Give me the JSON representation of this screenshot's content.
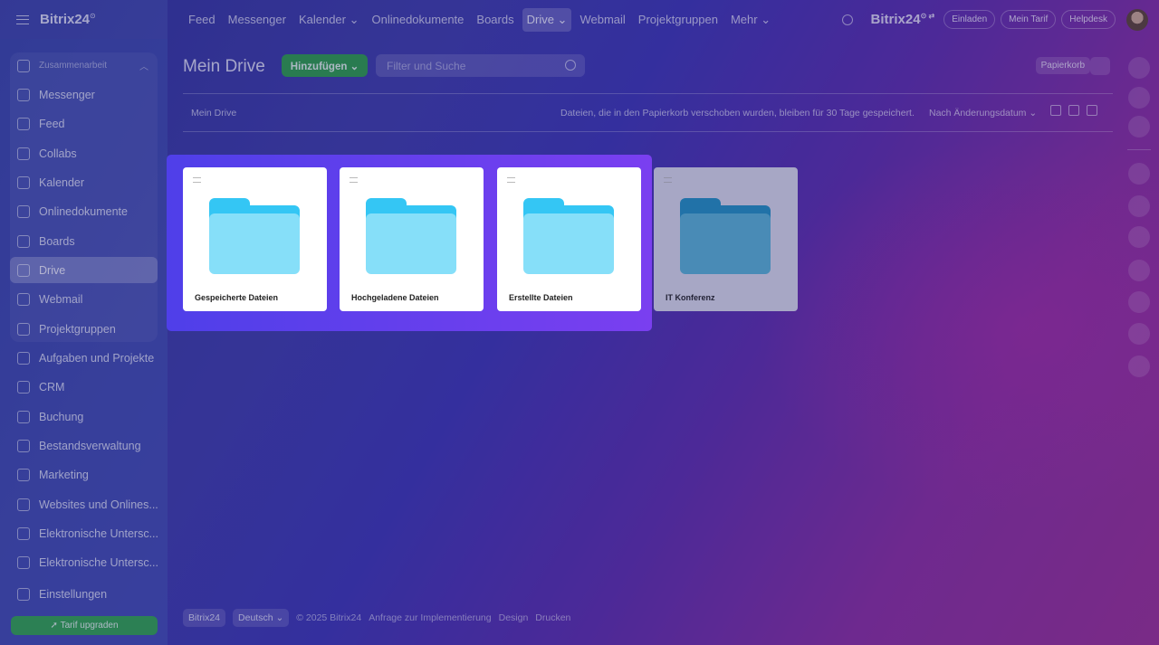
{
  "topbar": {
    "brand": "Bitrix24",
    "nav": [
      "Feed",
      "Messenger",
      "Kalender ⌄",
      "Onlinedokumente",
      "Boards",
      "Drive ⌄",
      "Webmail",
      "Projektgruppen",
      "Mehr ⌄"
    ],
    "active": 5,
    "right_brand": "Bitrix24",
    "buttons": [
      "Einladen",
      "Mein Tarif",
      "Helpdesk"
    ]
  },
  "sidebar": {
    "group_label": "Zusammenarbeit",
    "items": [
      "Messenger",
      "Feed",
      "Collabs",
      "Kalender",
      "Onlinedokumente",
      "Boards",
      "Drive",
      "Webmail",
      "Projektgruppen",
      "Aufgaben und Projekte",
      "CRM",
      "Buchung",
      "Bestandsverwaltung",
      "Marketing",
      "Websites und Onlines...",
      "Elektronische Untersc...",
      "Elektronische Untersc...",
      "Einstellungen"
    ],
    "active": "Drive",
    "upgrade": "Tarif upgraden"
  },
  "main": {
    "title": "Mein Drive",
    "add_label": "Hinzufügen ⌄",
    "filter_placeholder": "Filter und Suche",
    "trash_label": "Papierkorb",
    "breadcrumb": "Mein Drive",
    "info": "Dateien, die in den Papierkorb verschoben wurden, bleiben für 30 Tage gespeichert.",
    "sort": "Nach Änderungsdatum ⌄"
  },
  "folders": [
    "Gespeicherte Dateien",
    "Hochgeladene Dateien",
    "Erstellte Dateien",
    "IT Konferenz"
  ],
  "footer": {
    "brand": "Bitrix24",
    "lang": "Deutsch ⌄",
    "copyright": "© 2025 Bitrix24",
    "links": [
      "Anfrage zur Implementierung",
      "Design",
      "Drucken"
    ]
  },
  "colors": {
    "accent": "#2fa34a",
    "folder": "#34c6f4",
    "selection": "#5a3fe9"
  }
}
